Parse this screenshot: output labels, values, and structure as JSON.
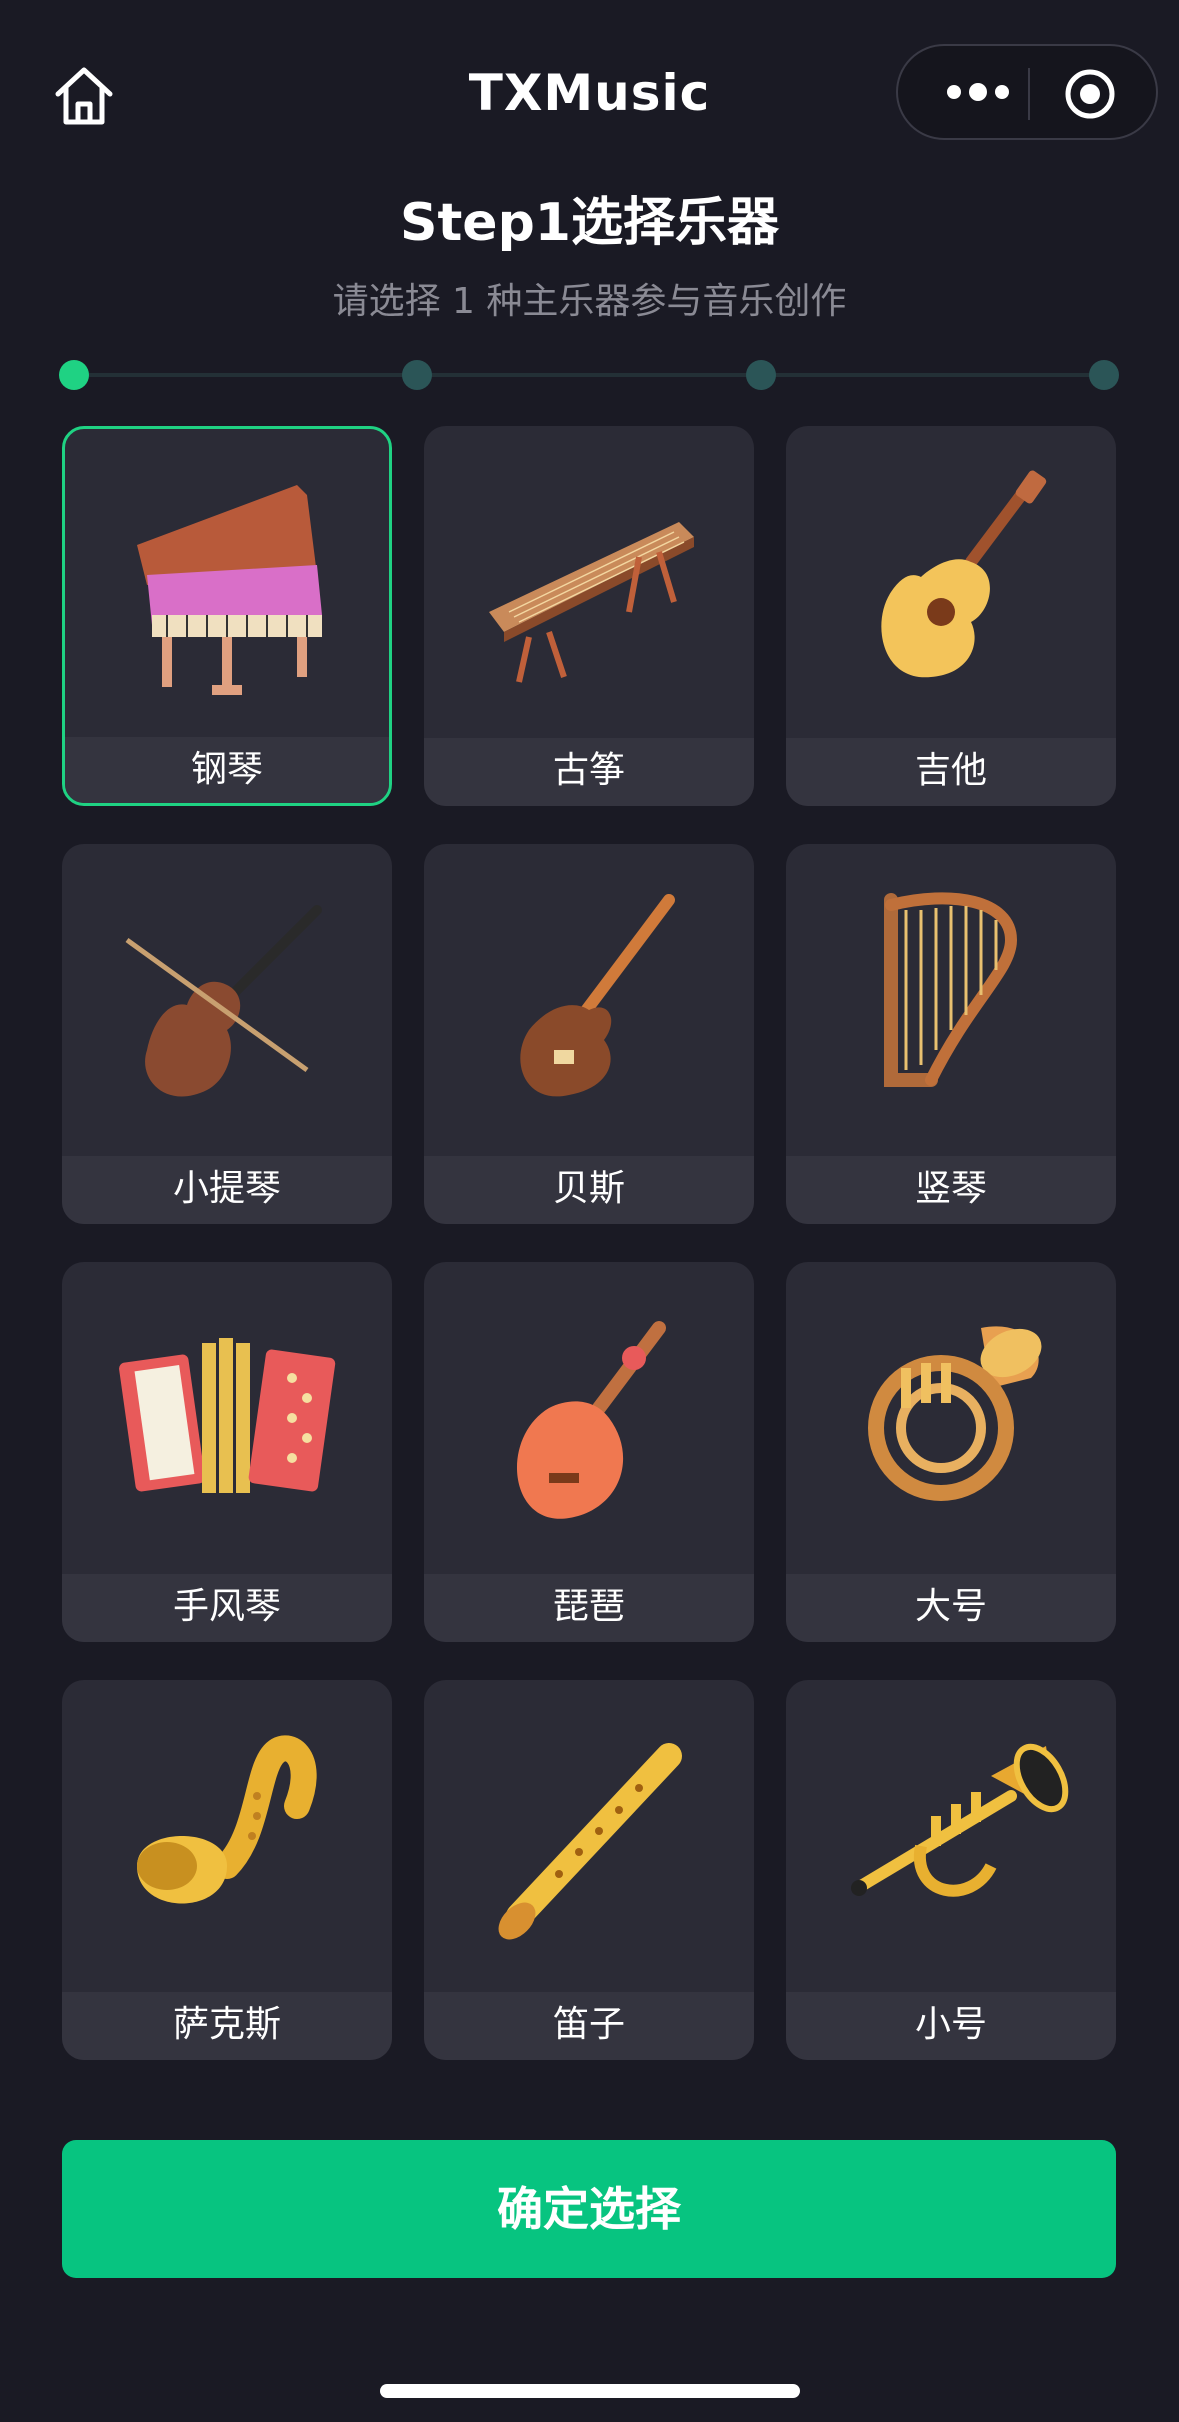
{
  "nav": {
    "title": "TXMusic",
    "home_icon": "home-icon",
    "more_icon": "more-dots-icon",
    "capsule_icon": "target-circle-icon"
  },
  "step": {
    "title": "Step1选择乐器",
    "subtitle": "请选择 1 种主乐器参与音乐创作"
  },
  "progress": {
    "total_steps": 4,
    "current_step": 1
  },
  "colors": {
    "accent": "#1fd283",
    "button": "#07c480",
    "background": "#1a1a24",
    "card": "#2b2b36"
  },
  "instruments": [
    {
      "label": "钢琴",
      "icon": "piano-icon",
      "selected": true
    },
    {
      "label": "古筝",
      "icon": "guzheng-icon",
      "selected": false
    },
    {
      "label": "吉他",
      "icon": "guitar-icon",
      "selected": false
    },
    {
      "label": "小提琴",
      "icon": "violin-icon",
      "selected": false
    },
    {
      "label": "贝斯",
      "icon": "bass-icon",
      "selected": false
    },
    {
      "label": "竖琴",
      "icon": "harp-icon",
      "selected": false
    },
    {
      "label": "手风琴",
      "icon": "accordion-icon",
      "selected": false
    },
    {
      "label": "琵琶",
      "icon": "pipa-icon",
      "selected": false
    },
    {
      "label": "大号",
      "icon": "tuba-icon",
      "selected": false
    },
    {
      "label": "萨克斯",
      "icon": "saxophone-icon",
      "selected": false
    },
    {
      "label": "笛子",
      "icon": "flute-icon",
      "selected": false
    },
    {
      "label": "小号",
      "icon": "trumpet-icon",
      "selected": false
    }
  ],
  "confirm_button": {
    "label": "确定选择"
  }
}
